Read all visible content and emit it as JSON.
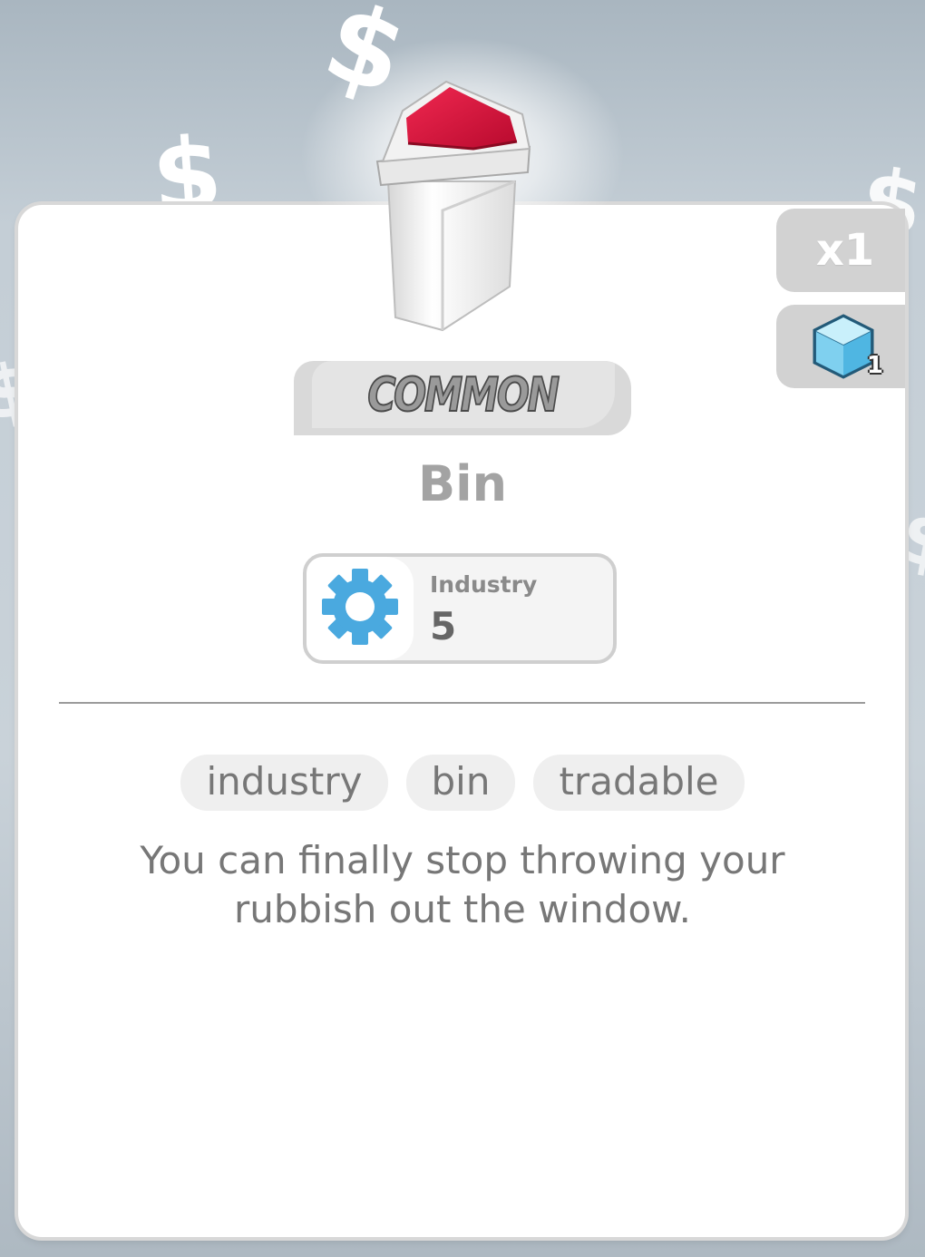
{
  "background": {
    "decorations": [
      "$",
      "$",
      "$",
      "$",
      "$"
    ]
  },
  "item": {
    "rarity": "COMMON",
    "name": "Bin",
    "quantity_label": "x1",
    "cube_count": "1",
    "stat": {
      "label": "Industry",
      "value": "5",
      "icon": "gear-icon"
    },
    "tags": [
      "industry",
      "bin",
      "tradable"
    ],
    "description": "You can finally stop throwing your rubbish out the window."
  },
  "colors": {
    "accent_blue": "#4aa9df",
    "bin_lid_red": "#d8103a"
  }
}
